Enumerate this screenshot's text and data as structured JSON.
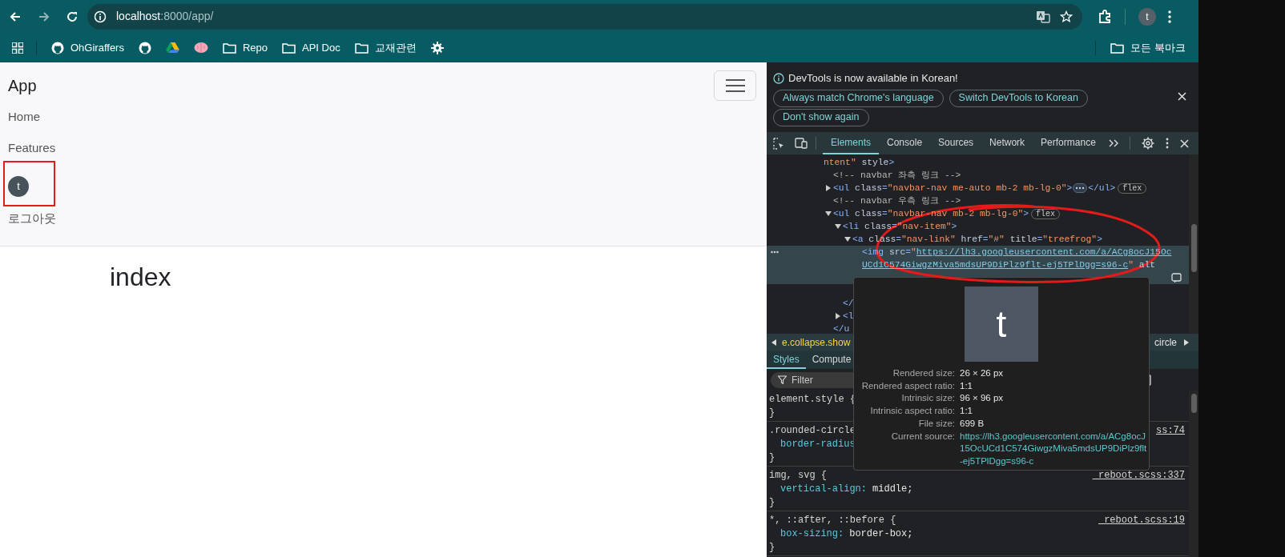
{
  "browser": {
    "address": {
      "host": "localhost",
      "path": ":8000/app/"
    },
    "profile_initial": "t",
    "bookmarks": [
      {
        "kind": "github",
        "label": "OhGiraffers"
      },
      {
        "kind": "github"
      },
      {
        "kind": "drive"
      },
      {
        "kind": "brain"
      },
      {
        "kind": "folder",
        "label": "Repo"
      },
      {
        "kind": "folder",
        "label": "API Doc"
      },
      {
        "kind": "folder",
        "label": "교재관련"
      },
      {
        "kind": "gear"
      }
    ],
    "all_bookmarks": "모든 북마크"
  },
  "page": {
    "brand": "App",
    "nav_links": [
      "Home",
      "Features"
    ],
    "avatar_initial": "t",
    "logout": "로그아웃",
    "heading": "index"
  },
  "devtools": {
    "banner": {
      "message": "DevTools is now available in Korean!",
      "buttons": [
        "Always match Chrome's language",
        "Switch DevTools to Korean",
        "Don't show again"
      ]
    },
    "tabs": [
      {
        "label": "Elements",
        "selected": true
      },
      {
        "label": "Console",
        "selected": false
      },
      {
        "label": "Sources",
        "selected": false
      },
      {
        "label": "Network",
        "selected": false
      },
      {
        "label": "Performance",
        "selected": false
      }
    ],
    "tree": {
      "selected": false,
      "line": [
        {
          "kind": "value",
          "text": "ntent\""
        },
        {
          "kind": "attr",
          "text": " style"
        },
        {
          "kind": "tag",
          "text": ">"
        }
      ],
      "children": [
        {
          "selected": false,
          "line": [
            {
              "kind": "comment",
              "text": "<!-- navbar 좌측 링크 -->"
            }
          ]
        },
        {
          "selected": false,
          "expanded": false,
          "badge": "flex",
          "line": [
            {
              "kind": "tag",
              "text": "<ul"
            },
            {
              "kind": "attr",
              "text": " class"
            },
            {
              "kind": "tag",
              "text": "="
            },
            {
              "kind": "value",
              "text": "\"navbar-nav me-auto mb-2 mb-lg-0\""
            },
            {
              "kind": "tag",
              "text": ">"
            },
            {
              "kind": "ellipsis"
            },
            {
              "kind": "tag",
              "text": "</ul>"
            }
          ]
        },
        {
          "selected": false,
          "line": [
            {
              "kind": "comment",
              "text": "<!-- navbar 우측 링크 -->"
            }
          ]
        },
        {
          "selected": false,
          "expanded": true,
          "badge": "flex",
          "line": [
            {
              "kind": "tag",
              "text": "<ul"
            },
            {
              "kind": "attr",
              "text": " class"
            },
            {
              "kind": "tag",
              "text": "="
            },
            {
              "kind": "value",
              "text": "\"navbar-nav mb-2 mb-lg-0\""
            },
            {
              "kind": "tag",
              "text": ">"
            }
          ],
          "closing": [
            {
              "kind": "tag",
              "text": "</u"
            }
          ],
          "children": [
            {
              "selected": false,
              "expanded": true,
              "line": [
                {
                  "kind": "tag",
                  "text": "<li"
                },
                {
                  "kind": "attr",
                  "text": " class"
                },
                {
                  "kind": "tag",
                  "text": "="
                },
                {
                  "kind": "value",
                  "text": "\"nav-item\""
                },
                {
                  "kind": "tag",
                  "text": ">"
                }
              ],
              "closing": [
                {
                  "kind": "tag",
                  "text": "</"
                }
              ],
              "children": [
                {
                  "selected": false,
                  "expanded": true,
                  "line": [
                    {
                      "kind": "tag",
                      "text": "<a"
                    },
                    {
                      "kind": "attr",
                      "text": " class"
                    },
                    {
                      "kind": "tag",
                      "text": "="
                    },
                    {
                      "kind": "value",
                      "text": "\"nav-link\""
                    },
                    {
                      "kind": "attr",
                      "text": " href"
                    },
                    {
                      "kind": "tag",
                      "text": "="
                    },
                    {
                      "kind": "value",
                      "text": "\"#\""
                    },
                    {
                      "kind": "attr",
                      "text": " title"
                    },
                    {
                      "kind": "tag",
                      "text": "="
                    },
                    {
                      "kind": "value",
                      "text": "\"treefrog\""
                    },
                    {
                      "kind": "tag",
                      "text": ">"
                    }
                  ],
                  "children": [
                    {
                      "selected": true,
                      "line": [
                        {
                          "kind": "tag",
                          "text": "<img"
                        },
                        {
                          "kind": "attr",
                          "text": " src"
                        },
                        {
                          "kind": "tag",
                          "text": "="
                        },
                        {
                          "kind": "value",
                          "text": "\""
                        },
                        {
                          "kind": "link",
                          "text": "https://lh3.googleusercontent.com/a/ACg8ocJ15Oc"
                        }
                      ],
                      "wrap": [
                        {
                          "kind": "link",
                          "text": "UCd1C574GiwgzMiva5mdsUP9DiPlz9flt-ej5TPlDgg=s96-c"
                        },
                        {
                          "kind": "value",
                          "text": "\""
                        },
                        {
                          "kind": "attr",
                          "text": " alt"
                        }
                      ]
                    }
                  ]
                }
              ]
            },
            {
              "selected": false,
              "expanded": false,
              "line": [
                {
                  "kind": "tag",
                  "text": "<l"
                }
              ]
            }
          ]
        }
      ]
    },
    "breadcrumbs": [
      "e.collapse.show",
      "circle"
    ],
    "sidebar_tabs": [
      {
        "label": "Styles",
        "selected": true
      },
      {
        "label": "Compute",
        "selected": false
      }
    ],
    "filter": {
      "placeholder": "Filter"
    },
    "rules": [
      {
        "selector": "element.style {",
        "close": "}"
      },
      {
        "selector": ".rounded-circle",
        "source": "ss:74",
        "declarations": [
          {
            "property": "border-radius"
          }
        ],
        "close": "}"
      },
      {
        "selector": "img, svg {",
        "source": "_reboot.scss:337",
        "declarations": [
          {
            "property": "vertical-align:",
            "value": "middle;"
          }
        ],
        "close": "}"
      },
      {
        "selector": "*, ::after, ::before {",
        "source": "_reboot.scss:19",
        "declarations": [
          {
            "property": "box-sizing:",
            "value": "border-box;"
          }
        ],
        "close": "}"
      }
    ],
    "tooltip": {
      "preview_initial": "t",
      "rows": [
        {
          "label": "Rendered size:",
          "value": "26 × 26 px"
        },
        {
          "label": "Rendered aspect ratio:",
          "value": "1:1"
        },
        {
          "label": "Intrinsic size:",
          "value": "96 × 96 px"
        },
        {
          "label": "Intrinsic aspect ratio:",
          "value": "1:1"
        },
        {
          "label": "File size:",
          "value": "699 B"
        },
        {
          "label": "Current source:",
          "value": "https://lh3.googleusercontent.com/a/ACg8ocJ15OcUCd1C574GiwgzMiva5mdsUP9DiPlz9flt-ej5TPlDgg=s96-c",
          "kind": "link"
        }
      ]
    }
  }
}
